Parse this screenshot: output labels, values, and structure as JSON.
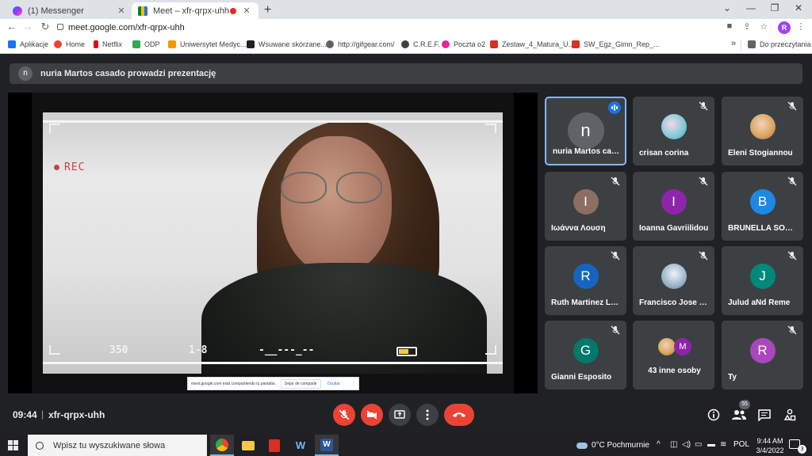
{
  "browser": {
    "tabs": [
      {
        "label": "(1) Messenger",
        "icon": "messenger-icon"
      },
      {
        "label": "Meet – xfr-qrpx-uhh",
        "icon": "google-meet-icon",
        "recording": true
      }
    ],
    "url": "meet.google.com/xfr-qrpx-uhh",
    "profile_initial": "R",
    "bookmarks": [
      {
        "label": "Aplikacje",
        "color": "#1a73e8"
      },
      {
        "label": "Home",
        "color": "#ea4335"
      },
      {
        "label": "Netflix",
        "color": "#e50914"
      },
      {
        "label": "ODP",
        "color": "#34a853"
      },
      {
        "label": "Uniwersytet Medyc...",
        "color": "#f29900"
      },
      {
        "label": "Wsuwane skórzane...",
        "color": "#202124"
      },
      {
        "label": "http://gifgear.com/",
        "color": "#5f6368"
      },
      {
        "label": "C.R.E.F.",
        "color": "#3c4043"
      },
      {
        "label": "Poczta o2",
        "color": "#e52592"
      },
      {
        "label": "Zestaw_4_Matura_U...",
        "color": "#d93025"
      },
      {
        "label": "SW_Egz_Gimn_Rep_...",
        "color": "#d93025"
      }
    ],
    "reading_list": "Do przeczytania"
  },
  "meet": {
    "presenter_initial": "n",
    "presenter_banner": "nuria Martos casado prowadzi prezentację",
    "presentation": {
      "rec_label": "REC",
      "counter": "350",
      "clip": "1-8",
      "timecode": "-__---_--"
    },
    "share_notice": {
      "text": "meet.google.com está compartiendo tu pantalla.",
      "stop": "Dejar de compartir",
      "hide": "Ocultar"
    },
    "participants": [
      {
        "name": "nuria Martos casa...",
        "initial": "n",
        "color": "#5f6368",
        "speaking": true
      },
      {
        "name": "crisan corina",
        "initial": "",
        "color": "#7ec9d6",
        "photo": true
      },
      {
        "name": "Eleni Stogiannou",
        "initial": "",
        "color": "#d9a35f",
        "photo": true
      },
      {
        "name": "Ιωάννα Λουση",
        "initial": "I",
        "color": "#8d6e63"
      },
      {
        "name": "Ioanna Gavriilidou",
        "initial": "I",
        "color": "#8e24aa"
      },
      {
        "name": "BRUNELLA SORBE...",
        "initial": "B",
        "color": "#1e88e5"
      },
      {
        "name": "Ruth Martinez Ló...",
        "initial": "R",
        "color": "#1565c0"
      },
      {
        "name": "Francisco Jose M...",
        "initial": "",
        "color": "#9bb6c9",
        "photo": true
      },
      {
        "name": "Julud aNd Reme",
        "initial": "J",
        "color": "#00897b"
      },
      {
        "name": "Gianni Esposito",
        "initial": "G",
        "color": "#00796b"
      },
      {
        "name": "43 inne osoby",
        "initial": "M",
        "color": "#8e24aa",
        "group": true
      },
      {
        "name": "Ty",
        "initial": "R",
        "color": "#ab47bc"
      }
    ],
    "time": "09:44",
    "separator": "|",
    "meeting_code": "xfr-qrpx-uhh",
    "participant_count": "55"
  },
  "taskbar": {
    "search_placeholder": "Wpisz tu wyszukiwane słowa",
    "weather": "0°C  Pochmurnie",
    "language": "POL",
    "clock_time": "9:44 AM",
    "clock_date": "3/4/2022",
    "notification_count": "3"
  }
}
